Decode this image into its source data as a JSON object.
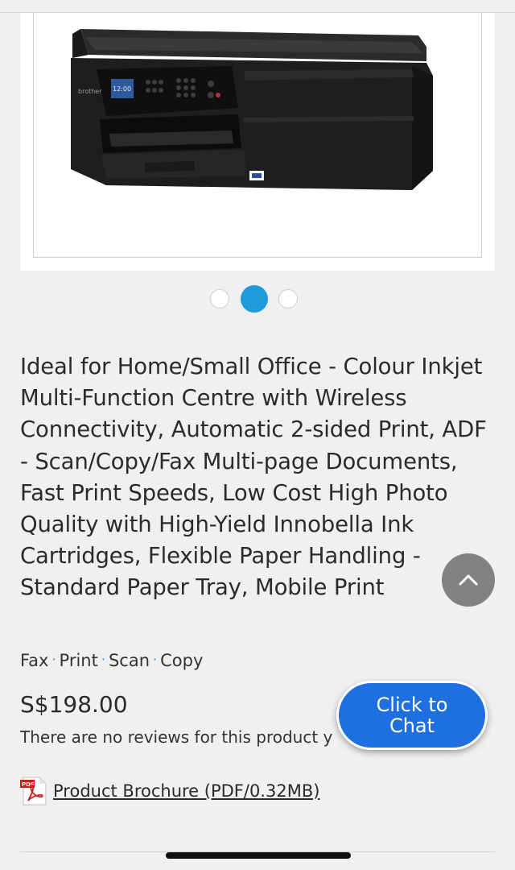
{
  "product": {
    "title": "Ideal for Home/Small Office - Colour Inkjet Multi-Function Centre with Wireless Connectivity, Automatic 2-sided Print, ADF - Scan/Copy/Fax Multi-page Documents, Fast Print Speeds, Low Cost High Photo Quality with High-Yield Innobella Ink Cartridges, Flexible Paper Handling - Standard Paper Tray, Mobile Print",
    "tags": [
      "Fax",
      "Print",
      "Scan",
      "Copy"
    ],
    "tag_separator": "·",
    "price": "S$198.00",
    "reviews_text": "There are no reviews for this product y",
    "brochure_label": "Product Brochure (PDF/0.32MB)",
    "printer_brand": "brother",
    "printer_screen_time": "12:00"
  },
  "carousel": {
    "slide_count": 3,
    "active_index": 1
  },
  "chat": {
    "line1": "Click to",
    "line2": "Chat"
  },
  "colors": {
    "accent": "#1e9bd8",
    "chat_button": "#1e6fe0",
    "background": "#f0f0f2"
  },
  "icons": {
    "scroll_top": "chevron-up-icon",
    "brochure": "pdf-icon"
  }
}
